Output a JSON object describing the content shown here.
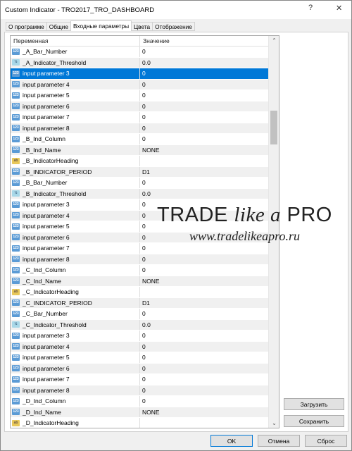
{
  "window": {
    "title": "Custom Indicator - TRO2017_TRO_DASHBOARD",
    "help": "?",
    "close": "✕"
  },
  "tabs": [
    {
      "label": "О программе"
    },
    {
      "label": "Общие"
    },
    {
      "label": "Входные параметры",
      "active": true
    },
    {
      "label": "Цвета"
    },
    {
      "label": "Отображение"
    }
  ],
  "table": {
    "headers": [
      "Переменная",
      "Значение"
    ],
    "rows": [
      {
        "t": "int",
        "name": "_A_Bar_Number",
        "value": "0"
      },
      {
        "t": "dbl",
        "name": "_A_Indicator_Threshold",
        "value": "0.0"
      },
      {
        "t": "int",
        "name": "input parameter 3",
        "value": "0",
        "selected": true
      },
      {
        "t": "int",
        "name": "input parameter 4",
        "value": "0"
      },
      {
        "t": "int",
        "name": "input parameter 5",
        "value": "0"
      },
      {
        "t": "int",
        "name": "input parameter 6",
        "value": "0"
      },
      {
        "t": "int",
        "name": "input parameter 7",
        "value": "0"
      },
      {
        "t": "int",
        "name": "input parameter 8",
        "value": "0"
      },
      {
        "t": "int",
        "name": "_B_Ind_Column",
        "value": "0"
      },
      {
        "t": "int",
        "name": "_B_Ind_Name",
        "value": "NONE"
      },
      {
        "t": "str",
        "name": "_B_IndicatorHeading",
        "value": ""
      },
      {
        "t": "int",
        "name": "_B_INDICATOR_PERIOD",
        "value": "D1"
      },
      {
        "t": "int",
        "name": "_B_Bar_Number",
        "value": "0"
      },
      {
        "t": "dbl",
        "name": "_B_Indicator_Threshold",
        "value": "0.0"
      },
      {
        "t": "int",
        "name": "input parameter 3",
        "value": "0"
      },
      {
        "t": "int",
        "name": "input parameter 4",
        "value": "0"
      },
      {
        "t": "int",
        "name": "input parameter 5",
        "value": "0"
      },
      {
        "t": "int",
        "name": "input parameter 6",
        "value": "0"
      },
      {
        "t": "int",
        "name": "input parameter 7",
        "value": "0"
      },
      {
        "t": "int",
        "name": "input parameter 8",
        "value": "0"
      },
      {
        "t": "int",
        "name": "_C_Ind_Column",
        "value": "0"
      },
      {
        "t": "int",
        "name": "_C_Ind_Name",
        "value": "NONE"
      },
      {
        "t": "str",
        "name": "_C_IndicatorHeading",
        "value": ""
      },
      {
        "t": "int",
        "name": "_C_INDICATOR_PERIOD",
        "value": "D1"
      },
      {
        "t": "int",
        "name": "_C_Bar_Number",
        "value": "0"
      },
      {
        "t": "dbl",
        "name": "_C_Indicator_Threshold",
        "value": "0.0"
      },
      {
        "t": "int",
        "name": "input parameter 3",
        "value": "0"
      },
      {
        "t": "int",
        "name": "input parameter 4",
        "value": "0"
      },
      {
        "t": "int",
        "name": "input parameter 5",
        "value": "0"
      },
      {
        "t": "int",
        "name": "input parameter 6",
        "value": "0"
      },
      {
        "t": "int",
        "name": "input parameter 7",
        "value": "0"
      },
      {
        "t": "int",
        "name": "input parameter 8",
        "value": "0"
      },
      {
        "t": "int",
        "name": "_D_Ind_Column",
        "value": "0"
      },
      {
        "t": "int",
        "name": "_D_Ind_Name",
        "value": "NONE"
      },
      {
        "t": "str",
        "name": "_D_IndicatorHeading",
        "value": ""
      }
    ]
  },
  "icons": {
    "int": "123",
    "dbl": "½",
    "str": "ab"
  },
  "buttons": {
    "load": "Загрузить",
    "save": "Сохранить",
    "ok": "OK",
    "cancel": "Отмена",
    "reset": "Сброс"
  },
  "watermark": {
    "line1a": "TRADE ",
    "line1b": "like a",
    "line1c": " PRO",
    "line2": "www.tradelikeapro.ru"
  },
  "colors": {
    "selection": "#0078d7"
  }
}
